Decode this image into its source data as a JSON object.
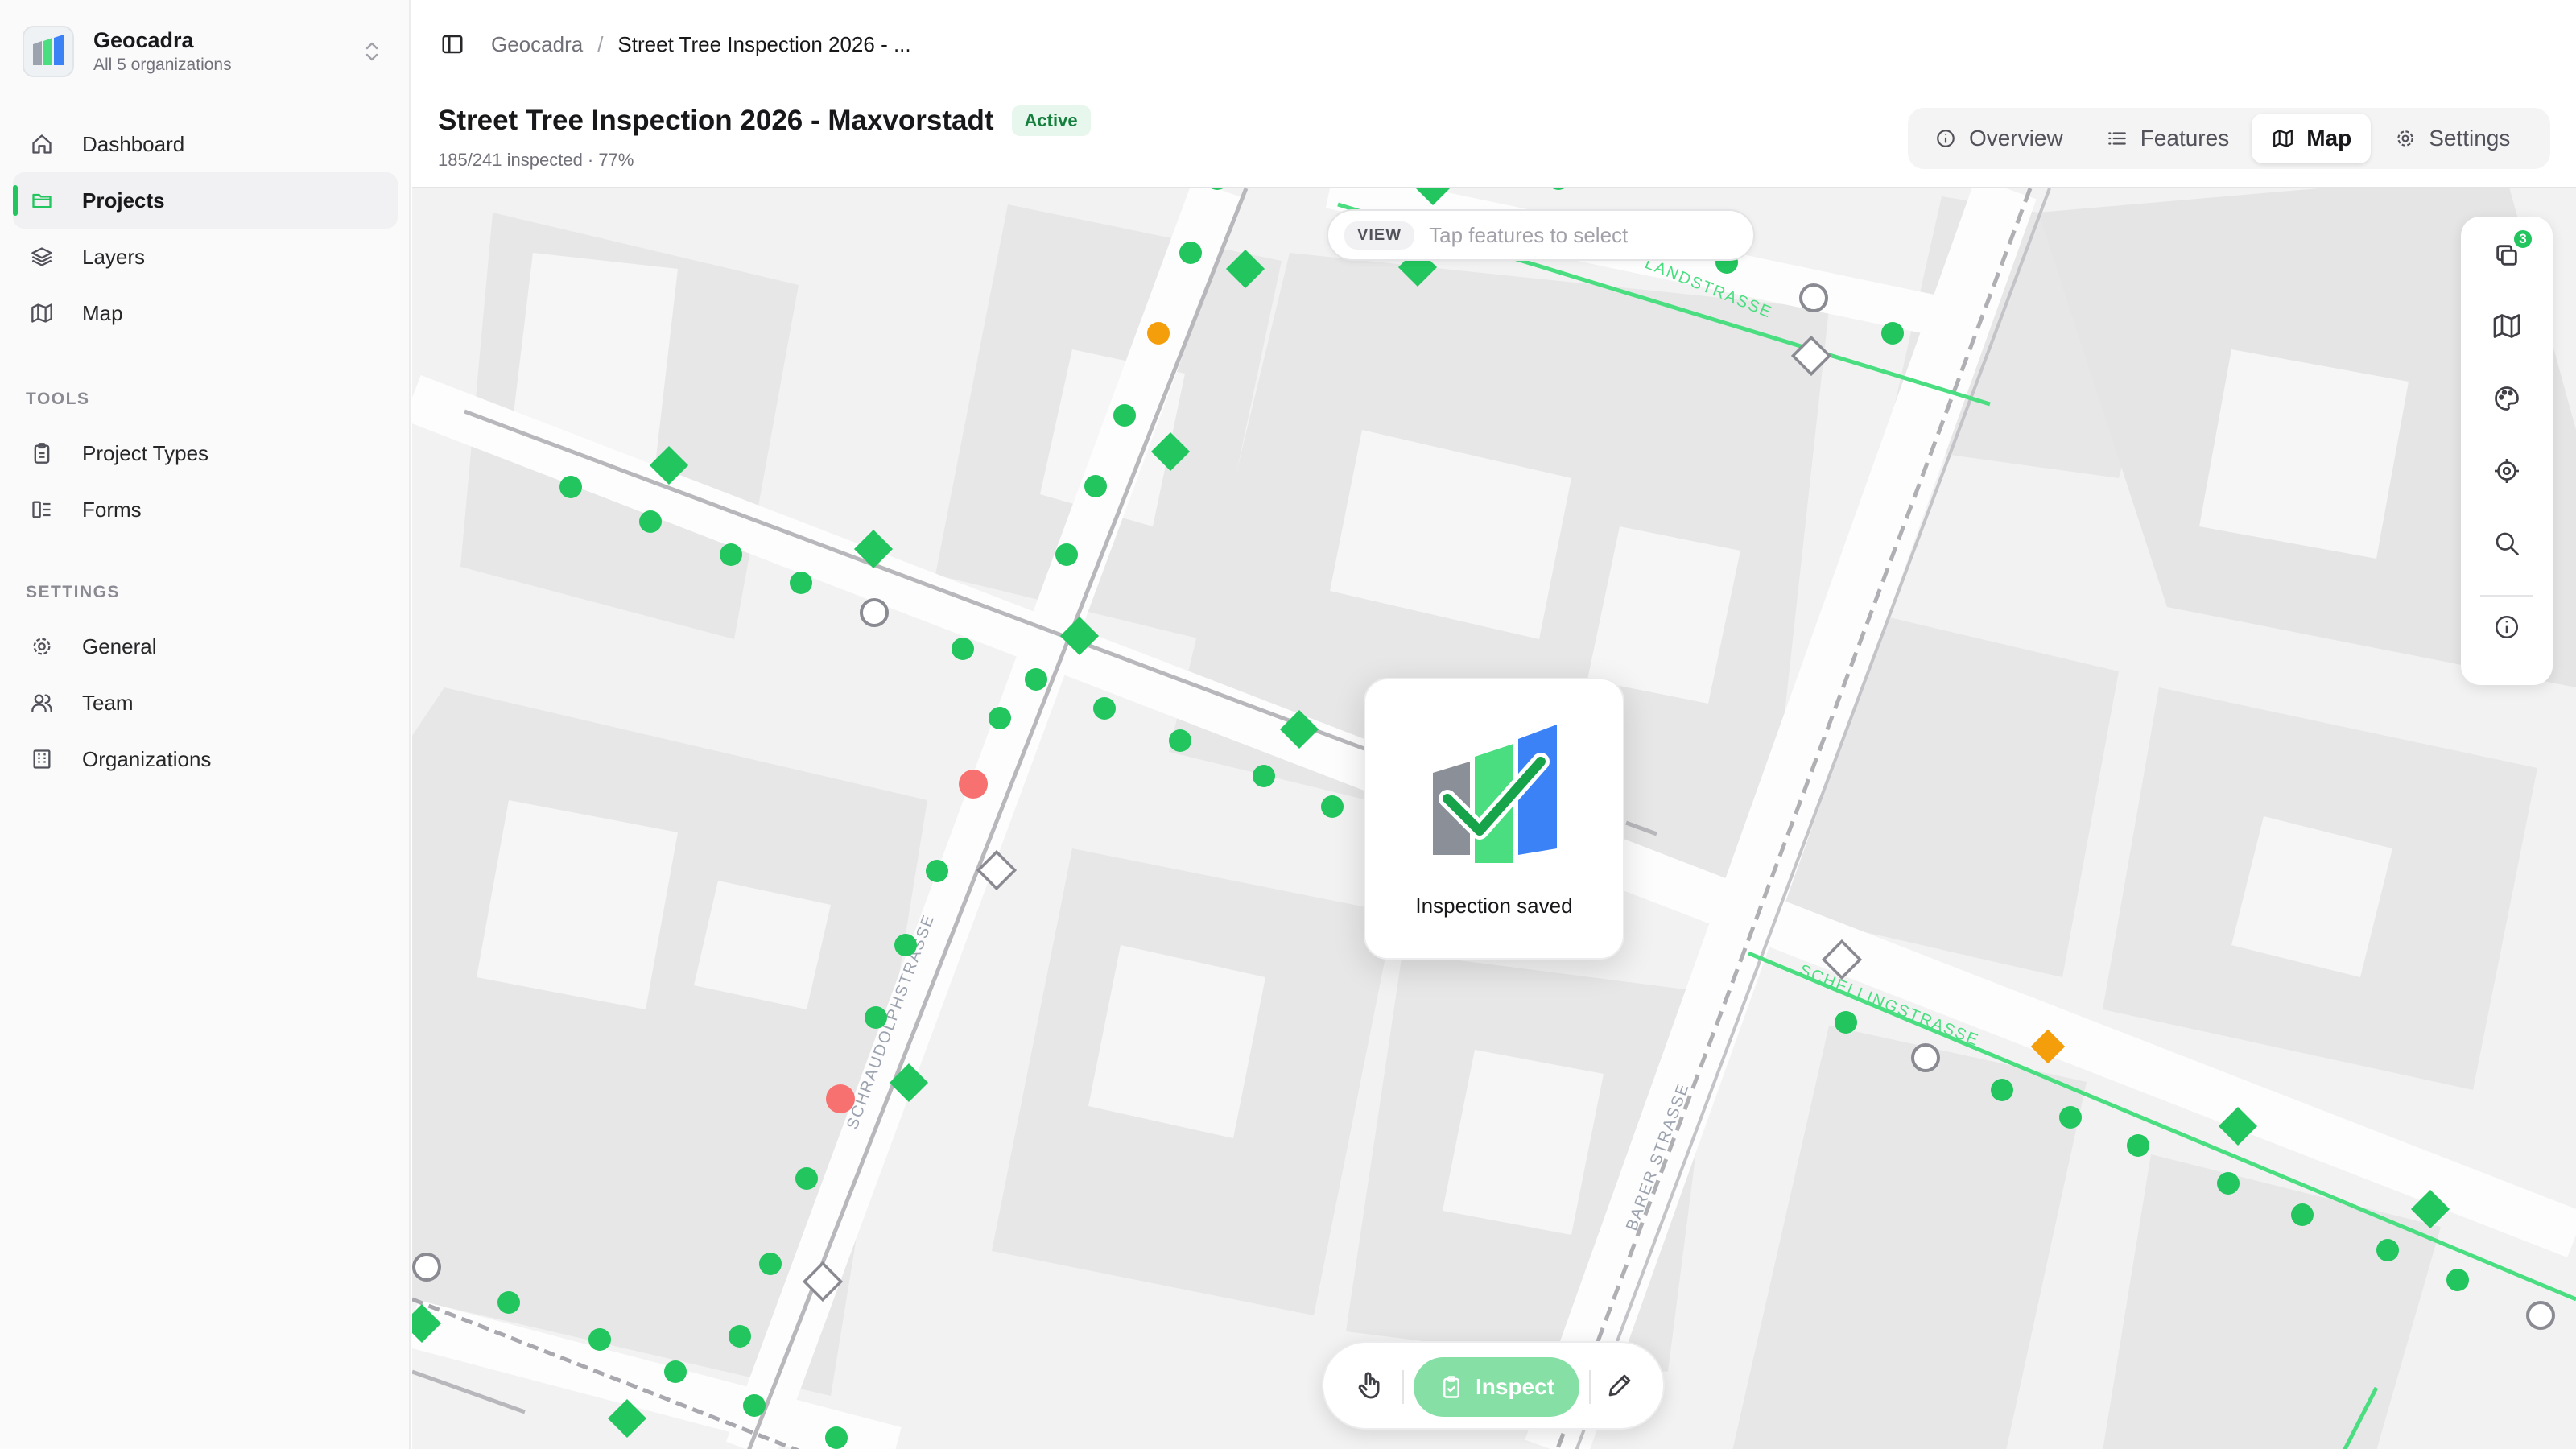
{
  "org": {
    "name": "Geocadra",
    "subtitle": "All 5 organizations"
  },
  "nav": {
    "main": [
      {
        "label": "Dashboard",
        "icon": "home-icon"
      },
      {
        "label": "Projects",
        "icon": "folder-icon",
        "active": true
      },
      {
        "label": "Layers",
        "icon": "layers-icon"
      },
      {
        "label": "Map",
        "icon": "map-icon"
      }
    ],
    "tools_label": "TOOLS",
    "tools": [
      {
        "label": "Project Types",
        "icon": "clipboard-icon"
      },
      {
        "label": "Forms",
        "icon": "form-icon"
      }
    ],
    "settings_label": "SETTINGS",
    "settings": [
      {
        "label": "General",
        "icon": "gear-icon"
      },
      {
        "label": "Team",
        "icon": "users-icon"
      },
      {
        "label": "Organizations",
        "icon": "building-icon"
      }
    ]
  },
  "breadcrumb": {
    "root": "Geocadra",
    "separator": "/",
    "current": "Street Tree Inspection 2026 - ..."
  },
  "project": {
    "title": "Street Tree Inspection 2026 - Maxvorstadt",
    "status": "Active",
    "progress_text": "185/241 inspected · 77%",
    "inspected": 185,
    "total": 241,
    "percent": 77
  },
  "tabs": [
    {
      "label": "Overview",
      "icon": "info-icon"
    },
    {
      "label": "Features",
      "icon": "list-icon"
    },
    {
      "label": "Map",
      "icon": "map-icon",
      "active": true
    },
    {
      "label": "Settings",
      "icon": "gear-icon"
    }
  ],
  "map": {
    "mode_tag": "VIEW",
    "mode_hint": "Tap features to select",
    "layer_count": "3",
    "toast_text": "Inspection saved",
    "inspect_label": "Inspect",
    "street_labels": [
      "LANDSTRASSE",
      "SCHRAUDOLPHSTRASSE",
      "SCHELLINGSTRASSE",
      "BARER STRASSE"
    ],
    "colors": {
      "inspected": "#22c55e",
      "issue": "#f87171",
      "warning": "#f59e0b",
      "uninspected": "#ffffff"
    }
  }
}
